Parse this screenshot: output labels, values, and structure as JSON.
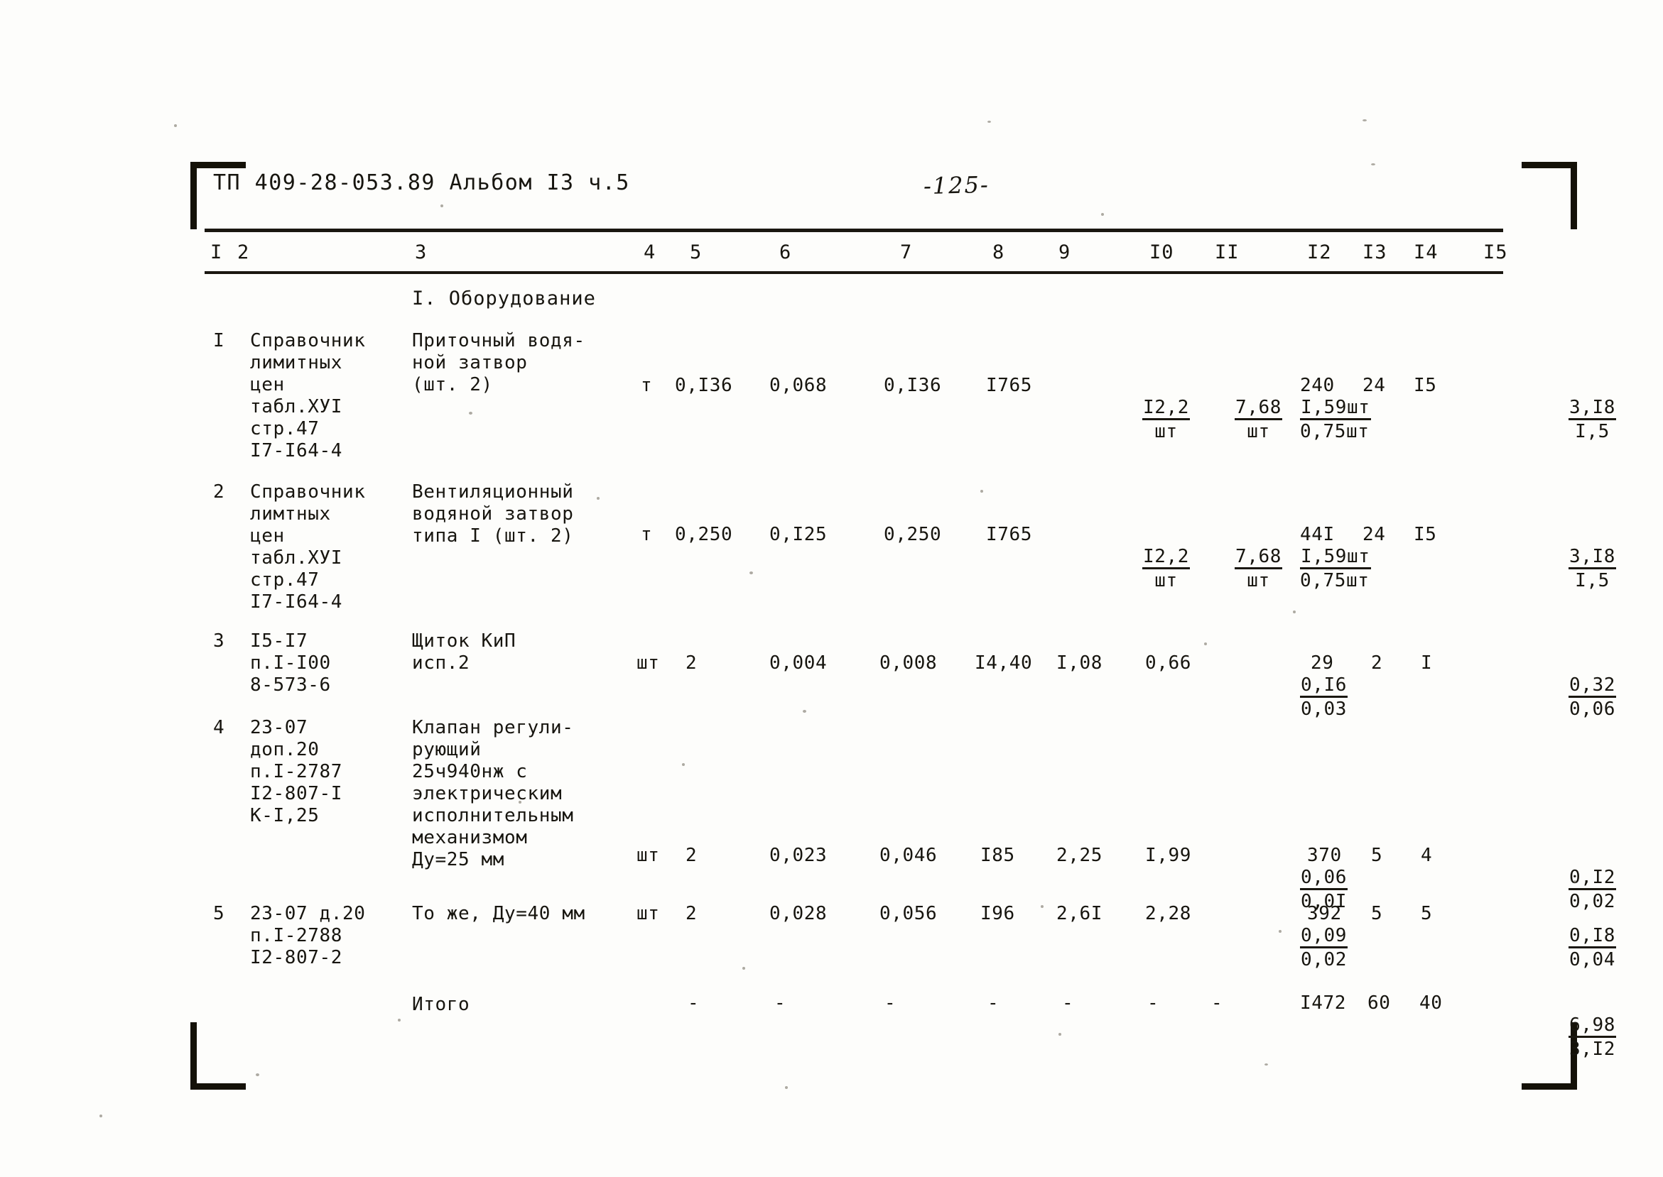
{
  "document": {
    "header": "ТП 409-28-053.89 Альбом I3 ч.5",
    "page_number": "-125-"
  },
  "table": {
    "column_headers": [
      "I",
      "2",
      "3",
      "4",
      "5",
      "6",
      "7",
      "8",
      "9",
      "I0",
      "II",
      "I2",
      "I3",
      "I4",
      "I5"
    ],
    "section_title": "I. Оборудование",
    "total_label": "Итого",
    "dash_mark": "-",
    "rows": [
      {
        "num": "I",
        "code": "Справочник\nлимитных\nцен\nтабл.ХУI\nстр.47\nI7-I64-4",
        "name": "Приточный водя-\nной затвор\n(шт. 2)",
        "unit": "т",
        "c5": "0,I36",
        "c6": "0,068",
        "c7": "0,I36",
        "c8": "I765",
        "c9_num": "I2,2",
        "c9_den": "шт",
        "c10_num": "7,68",
        "c10_den": "шт",
        "c11_num": "I,59шт",
        "c11_den": "0,75шт",
        "c12": "240",
        "c13": "24",
        "c14": "I5",
        "c15_num": "3,I8",
        "c15_den": "I,5"
      },
      {
        "num": "2",
        "code": "Справочник\nлимтных\nцен\nтабл.ХУI\nстр.47\nI7-I64-4",
        "name": "Вентиляционный\nводяной затвор\nтипа I (шт. 2)",
        "unit": "т",
        "c5": "0,250",
        "c6": "0,I25",
        "c7": "0,250",
        "c8": "I765",
        "c9_num": "I2,2",
        "c9_den": "шт",
        "c10_num": "7,68",
        "c10_den": "шт",
        "c11_num": "I,59шт",
        "c11_den": "0,75шт",
        "c12": "44I",
        "c13": "24",
        "c14": "I5",
        "c15_num": "3,I8",
        "c15_den": "I,5"
      },
      {
        "num": "3",
        "code": "I5-I7\nп.I-I00\n8-573-6",
        "name": "Щиток КиП\nисп.2",
        "unit": "шт",
        "c5": "2",
        "c6": "0,004",
        "c7": "0,008",
        "c8": "I4,40",
        "c9": "I,08",
        "c10": "0,66",
        "c11_num": "0,I6",
        "c11_den": "0,03",
        "c12": "29",
        "c13": "2",
        "c14": "I",
        "c15_num": "0,32",
        "c15_den": "0,06"
      },
      {
        "num": "4",
        "code": "23-07\nдоп.20\nп.I-2787\nI2-807-I\nК-I,25",
        "name": "Клапан регули-\nрующий\n25ч940нж с\nэлектрическим\nисполнительным\nмеханизмом\nДу=25 мм",
        "unit": "шт",
        "c5": "2",
        "c6": "0,023",
        "c7": "0,046",
        "c8": "I85",
        "c9": "2,25",
        "c10": "I,99",
        "c11_num": "0,06",
        "c11_den": "0,0I",
        "c12": "370",
        "c13": "5",
        "c14": "4",
        "c15_num": "0,I2",
        "c15_den": "0,02"
      },
      {
        "num": "5",
        "code": "23-07 д.20\nп.I-2788\nI2-807-2",
        "name": "То же, Ду=40 мм",
        "unit": "шт",
        "c5": "2",
        "c6": "0,028",
        "c7": "0,056",
        "c8": "I96",
        "c9": "2,6I",
        "c10": "2,28",
        "c11_num": "0,09",
        "c11_den": "0,02",
        "c12": "392",
        "c13": "5",
        "c14": "5",
        "c15_num": "0,I8",
        "c15_den": "0,04"
      }
    ],
    "totals": {
      "c12": "I472",
      "c13": "60",
      "c14": "40",
      "c15_num": "6,98",
      "c15_den": "3,I2"
    }
  }
}
